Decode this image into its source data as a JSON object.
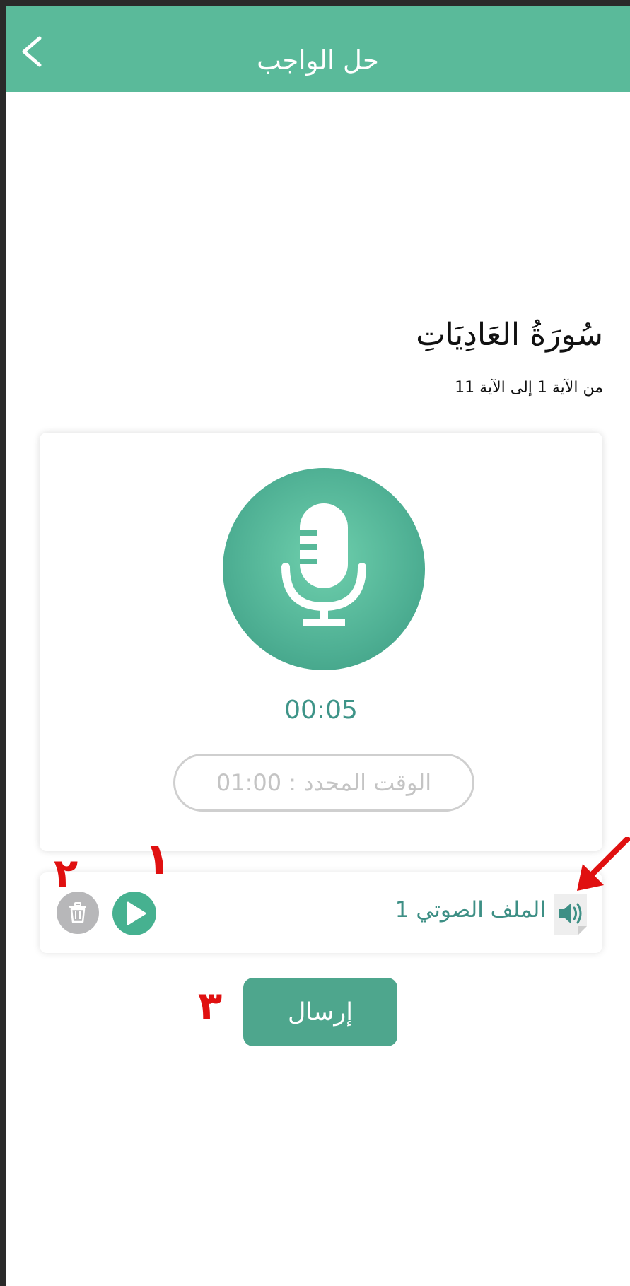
{
  "header": {
    "title": "حل الواجب",
    "back_icon": "chevron-left-icon",
    "color": "#5aba9a"
  },
  "surah": {
    "title": "سُورَةُ العَادِيَاتِ",
    "ayah_range": "من الآية 1 إلى الآية 11"
  },
  "recorder": {
    "mic_icon": "microphone-icon",
    "timer": "00:05",
    "time_limit": "الوقت المحدد : 01:00",
    "accent_color": "#4fb094"
  },
  "audio_file": {
    "name": "الملف الصوتي 1",
    "file_icon": "audio-file-icon",
    "play_icon": "play-icon",
    "delete_icon": "trash-icon"
  },
  "actions": {
    "send_label": "إرسال"
  },
  "annotations": {
    "label_1": "١",
    "label_2": "٢",
    "label_3": "٣",
    "color": "#e01010"
  }
}
